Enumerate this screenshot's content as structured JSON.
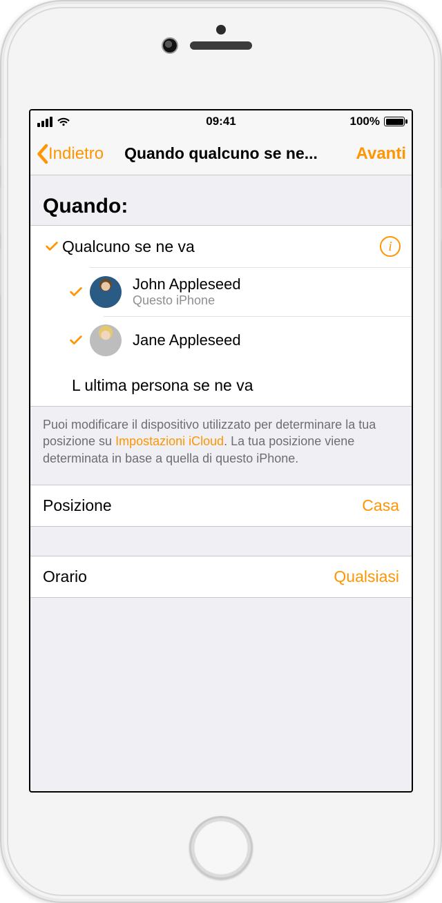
{
  "status": {
    "time": "09:41",
    "battery_pct": "100%"
  },
  "nav": {
    "back": "Indietro",
    "title": "Quando qualcuno se ne...",
    "next": "Avanti"
  },
  "section_header": "Quando:",
  "options": {
    "someone_leaves": {
      "label": "Qualcuno se ne va",
      "checked": true
    },
    "people": [
      {
        "name": "John Appleseed",
        "note": "Questo iPhone",
        "checked": true
      },
      {
        "name": "Jane Appleseed",
        "note": "",
        "checked": true
      }
    ],
    "last_person": {
      "label": "L ultima persona se ne va",
      "checked": false
    }
  },
  "footnote": {
    "pre": "Puoi modificare il dispositivo utilizzato per determinare la tua posizione su ",
    "link": "Impostazioni iCloud",
    "post": ". La tua posizione viene determinata in base a quella di questo iPhone."
  },
  "kv": {
    "position": {
      "label": "Posizione",
      "value": "Casa"
    },
    "time": {
      "label": "Orario",
      "value": "Qualsiasi"
    }
  },
  "colors": {
    "accent": "#ff9500"
  }
}
